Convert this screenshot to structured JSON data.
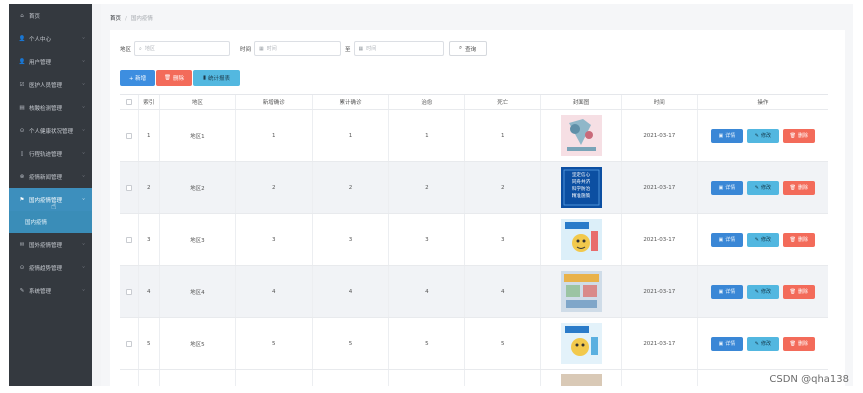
{
  "sidebar": {
    "items": [
      {
        "icon": "⌂",
        "icon_name": "home-icon",
        "label": "首页",
        "arrow": false
      },
      {
        "icon": "👤",
        "icon_name": "user-icon",
        "label": "个人中心",
        "arrow": true
      },
      {
        "icon": "👤",
        "icon_name": "user-icon",
        "label": "用户管理",
        "arrow": true
      },
      {
        "icon": "☑",
        "icon_name": "checkbox-icon",
        "label": "医护人员管理",
        "arrow": true
      },
      {
        "icon": "▤",
        "icon_name": "list-icon",
        "label": "核酸检测管理",
        "arrow": true
      },
      {
        "icon": "⊙",
        "icon_name": "circle-icon",
        "label": "个人健康状况管理",
        "arrow": true
      },
      {
        "icon": "▯",
        "icon_name": "phone-icon",
        "label": "行程轨迹管理",
        "arrow": true
      },
      {
        "icon": "⊗",
        "icon_name": "gear-icon",
        "label": "疫情新闻管理",
        "arrow": true
      },
      {
        "icon": "⚑",
        "icon_name": "flag-icon",
        "label": "国内疫情管理",
        "arrow": true,
        "active": true
      },
      {
        "icon": "✉",
        "icon_name": "mail-icon",
        "label": "国外疫情管理",
        "arrow": true
      },
      {
        "icon": "⊙",
        "icon_name": "circle-icon",
        "label": "疫情趋势管理",
        "arrow": true
      },
      {
        "icon": "✎",
        "icon_name": "wrench-icon",
        "label": "系统管理",
        "arrow": true
      }
    ],
    "submenu_label": "国内疫情"
  },
  "breadcrumb": {
    "home": "首页",
    "separator": "/",
    "current": "国内疫情"
  },
  "search": {
    "area_label": "地区",
    "area_placeholder": "地区",
    "time_label": "时间",
    "time_from_placeholder": "时间",
    "to_label": "至",
    "time_to_placeholder": "时间",
    "search_button": "查询"
  },
  "actions": {
    "add": "+ 新增",
    "delete": "删除",
    "stats": "统计报表"
  },
  "table": {
    "headers": [
      "索引",
      "地区",
      "新增确诊",
      "累计确诊",
      "治愈",
      "死亡",
      "封面图",
      "时间",
      "操作"
    ],
    "rows": [
      {
        "index": "1",
        "area": "地区1",
        "new": "1",
        "total": "1",
        "cured": "1",
        "death": "1",
        "time": "2021-03-17"
      },
      {
        "index": "2",
        "area": "地区2",
        "new": "2",
        "total": "2",
        "cured": "2",
        "death": "2",
        "time": "2021-03-17"
      },
      {
        "index": "3",
        "area": "地区3",
        "new": "3",
        "total": "3",
        "cured": "3",
        "death": "3",
        "time": "2021-03-17"
      },
      {
        "index": "4",
        "area": "地区4",
        "new": "4",
        "total": "4",
        "cured": "4",
        "death": "4",
        "time": "2021-03-17"
      },
      {
        "index": "5",
        "area": "地区5",
        "new": "5",
        "total": "5",
        "cured": "5",
        "death": "5",
        "time": "2021-03-17"
      }
    ],
    "cover_texts": {
      "row2": "坚定信心\n同舟共济\n科学防治\n精准施策"
    },
    "op_detail": "详情",
    "op_edit": "修改",
    "op_delete": "删除"
  },
  "watermark": "CSDN @qha138",
  "colors": {
    "sidebar_bg": "#34393f",
    "active": "#3d8fbd",
    "primary": "#3a87d6",
    "info": "#52b7e0",
    "danger": "#f36b5a"
  }
}
